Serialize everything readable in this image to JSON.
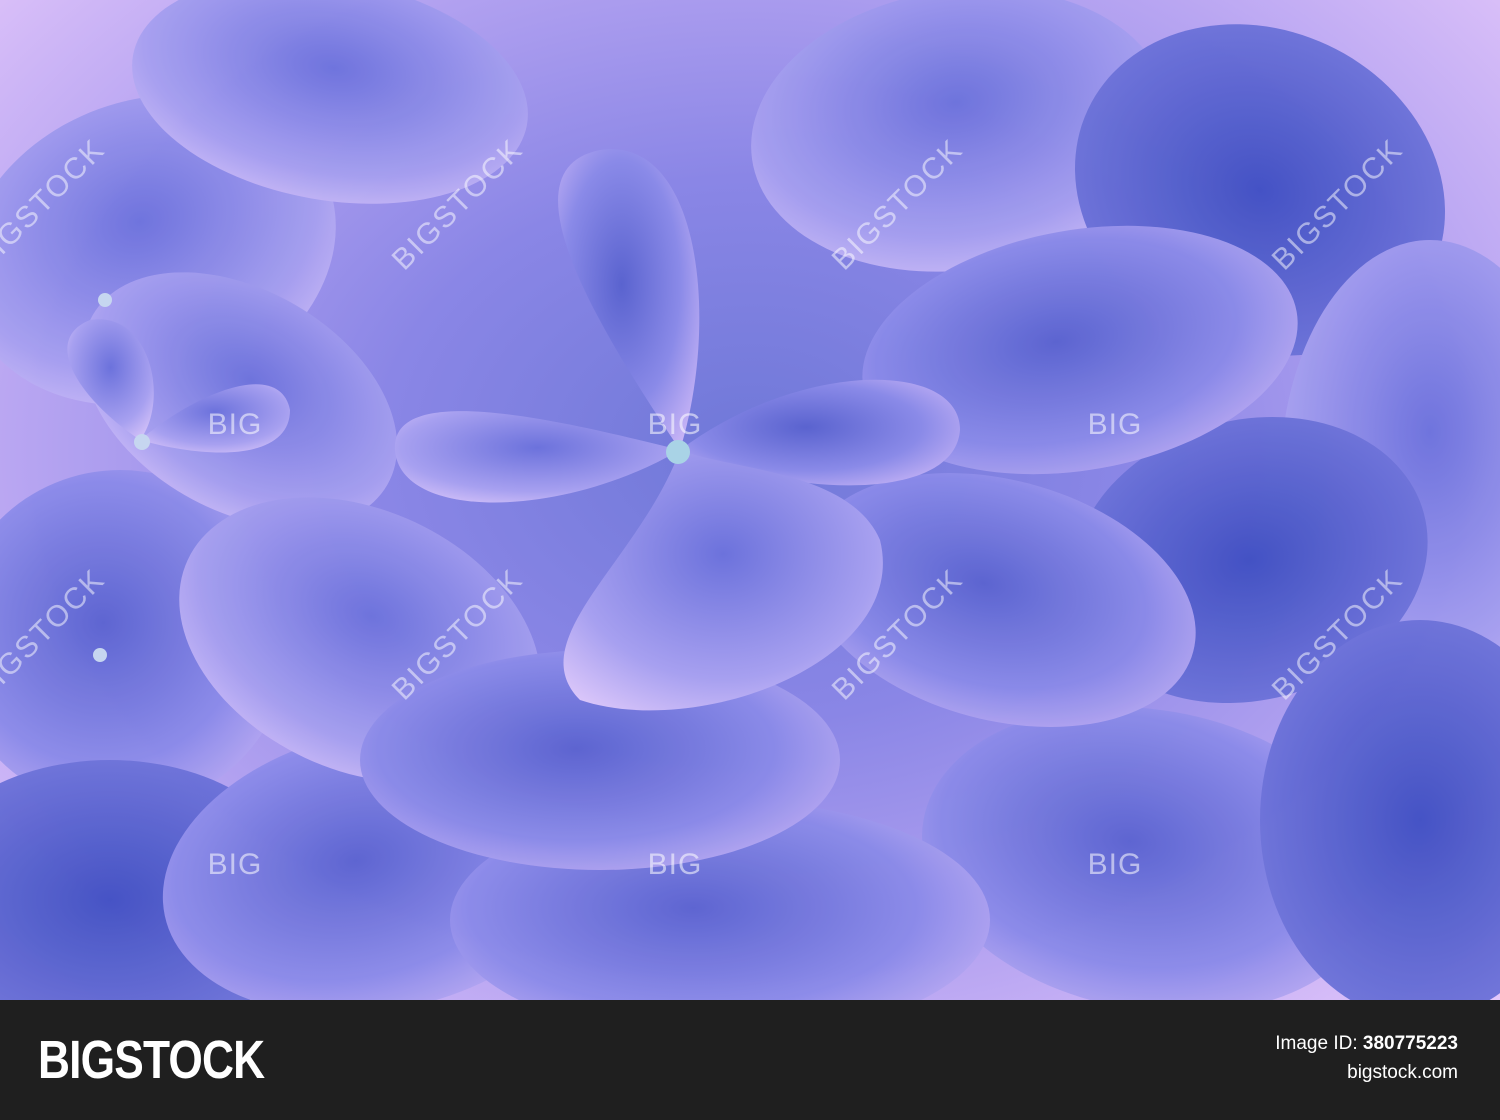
{
  "photo": {
    "subject": "hydrangea-flower",
    "colors": {
      "deep": "#4f5fd0",
      "mid": "#8f8ef0",
      "light": "#ddc2fb",
      "center": "#a9d3e6"
    }
  },
  "watermarks": {
    "small": "BIG",
    "diagonal": "BIGSTOCK"
  },
  "footer": {
    "brand": "BIGSTOCK",
    "image_id_label": "Image ID:",
    "image_id_value": "380775223",
    "site": "bigstock.com"
  }
}
